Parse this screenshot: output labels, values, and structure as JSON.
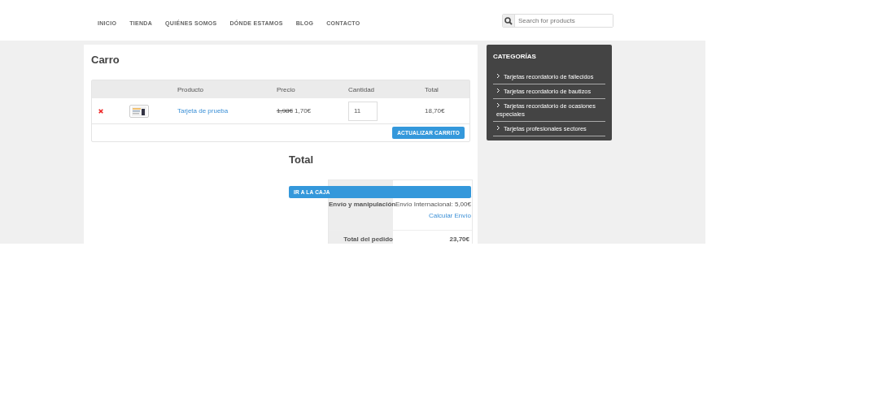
{
  "nav": [
    "INICIO",
    "TIENDA",
    "QUIÉNES SOMOS",
    "DÓNDE ESTAMOS",
    "BLOG",
    "CONTACTO"
  ],
  "search": {
    "placeholder": "Search for products"
  },
  "cart": {
    "title": "Carro",
    "columns": [
      "Producto",
      "Precio",
      "Cantidad",
      "Total"
    ],
    "rows": [
      {
        "product": "Tarjeta de prueba",
        "old_price": "1,98€",
        "price": "1,70€",
        "quantity": "11",
        "total": "18,70€"
      }
    ],
    "update_button": "ACTUALIZAR CARRITO"
  },
  "totals": {
    "title": "Total",
    "checkout_button": "IR A LA CAJA",
    "rows": [
      {
        "kind": "covered"
      },
      {
        "kind": "shipping",
        "label": "Envío y manipulación",
        "value": "Envío Internacional: 5,00€",
        "link": "Calcular Envío"
      },
      {
        "kind": "total",
        "label": "Total del pedido",
        "value": "23,70€"
      }
    ]
  },
  "sidebar": {
    "title": "CATEGORÍAS",
    "items": [
      "Tarjetas recordatorio de fallecidos",
      "Tarjetas recordatorio de bautizos",
      "Tarjetas recordatorio de ocasiones especiales",
      "Tarjetas profesionales sectores"
    ]
  }
}
